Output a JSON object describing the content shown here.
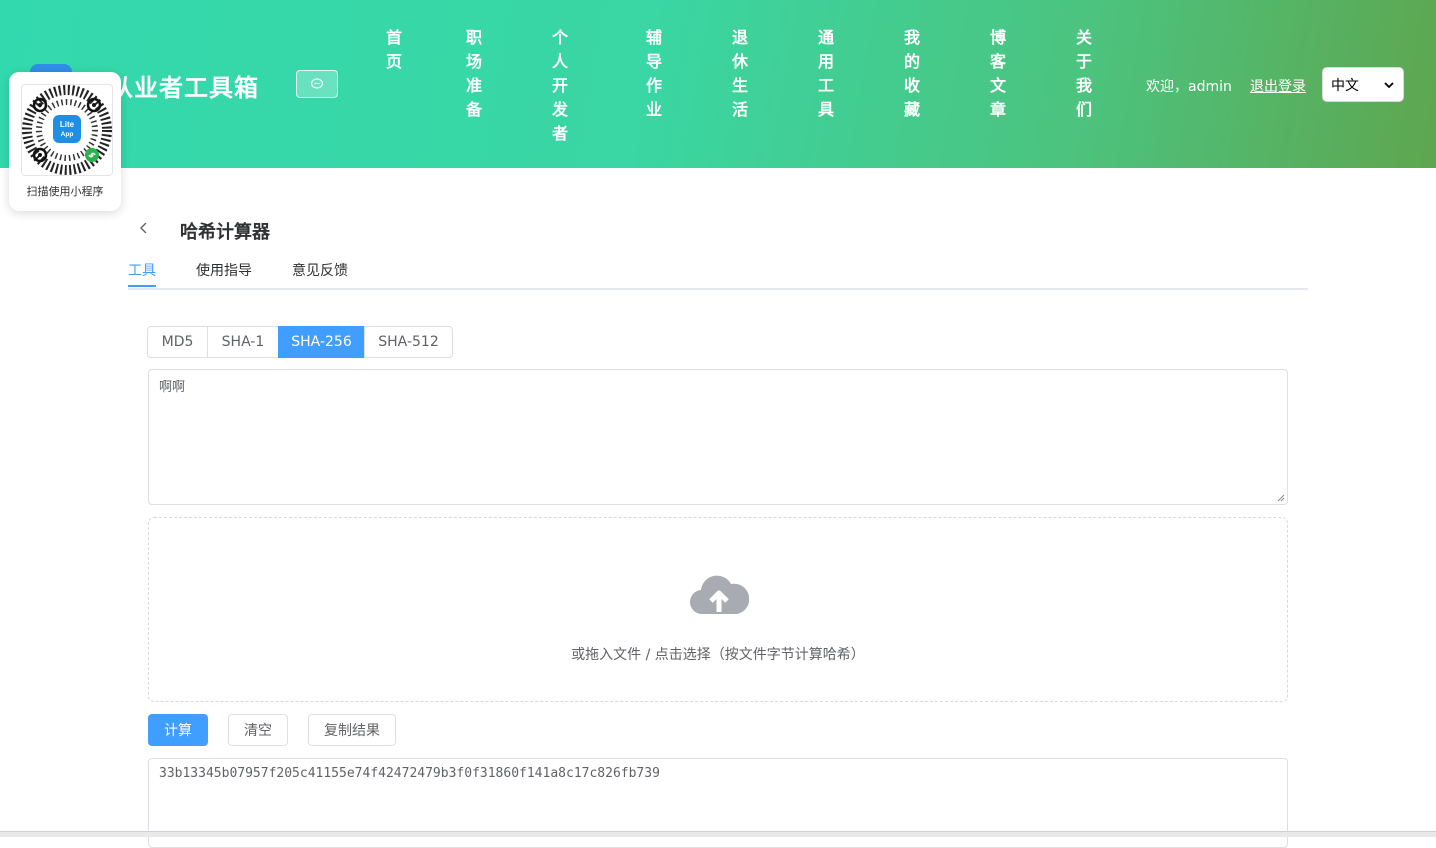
{
  "header": {
    "site_title": "件从业者工具箱",
    "nav": [
      {
        "label": "首页"
      },
      {
        "label": "职场准备"
      },
      {
        "label": "个人开发者"
      },
      {
        "label": "辅导作业"
      },
      {
        "label": "退休生活"
      },
      {
        "label": "通用工具"
      },
      {
        "label": "我的收藏"
      },
      {
        "label": "博客文章"
      },
      {
        "label": "关于我们"
      }
    ],
    "welcome": "欢迎，admin",
    "logout": "退出登录",
    "language": "中文",
    "gradient_colors": [
      "#33d9ae",
      "#5ea64f"
    ]
  },
  "mini_program": {
    "caption": "扫描使用小程序",
    "badge_top": "Lite",
    "badge_bottom": "App"
  },
  "page": {
    "title": "哈希计算器",
    "tabs": [
      {
        "label": "工具",
        "active": true
      },
      {
        "label": "使用指导",
        "active": false
      },
      {
        "label": "意见反馈",
        "active": false
      }
    ]
  },
  "tool": {
    "algorithms": [
      {
        "label": "MD5",
        "active": false
      },
      {
        "label": "SHA-1",
        "active": false
      },
      {
        "label": "SHA-256",
        "active": true
      },
      {
        "label": "SHA-512",
        "active": false
      }
    ],
    "input_value": "啊啊",
    "dropzone_text": "或拖入文件 / 点击选择（按文件字节计算哈希）",
    "buttons": {
      "compute": "计算",
      "clear": "清空",
      "copy": "复制结果"
    },
    "result": "33b13345b07957f205c41155e74f42472479b3f0f31860f141a8c17c826fb739",
    "accent_color": "#409eff"
  }
}
